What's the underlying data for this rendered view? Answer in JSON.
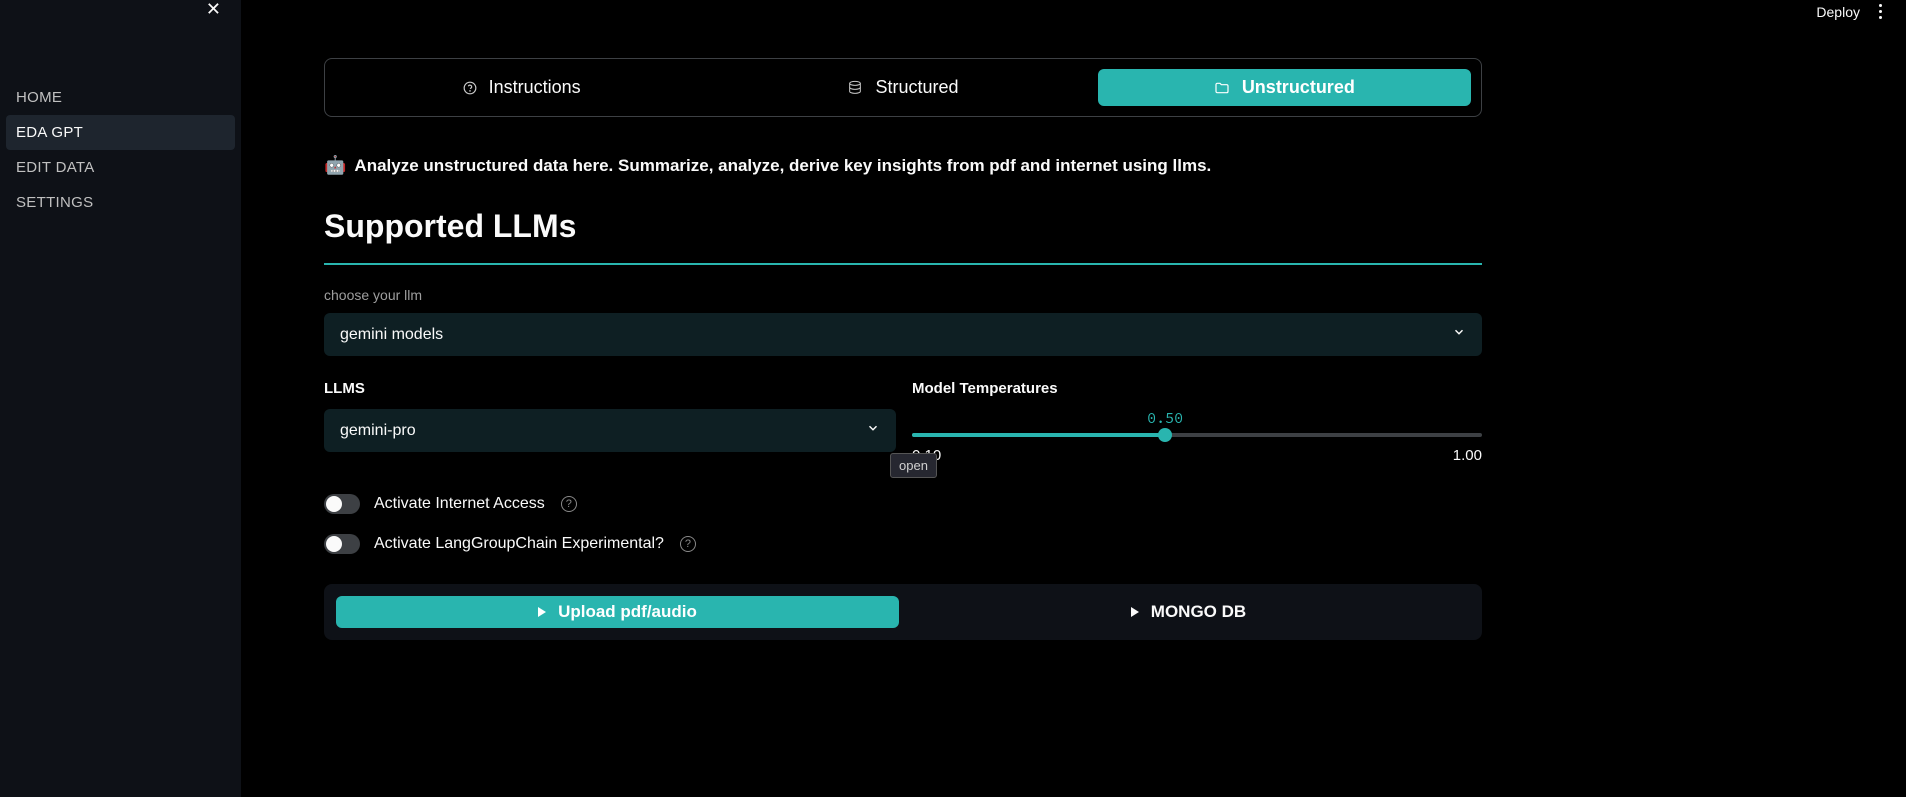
{
  "header": {
    "deploy_label": "Deploy"
  },
  "sidebar": {
    "items": [
      {
        "label": "HOME"
      },
      {
        "label": "EDA GPT"
      },
      {
        "label": "EDIT DATA"
      },
      {
        "label": "SETTINGS"
      }
    ],
    "active_index": 1
  },
  "tabs": {
    "items": [
      {
        "label": "Instructions"
      },
      {
        "label": "Structured"
      },
      {
        "label": "Unstructured"
      }
    ],
    "active_index": 2
  },
  "description": "Analyze unstructured data here. Summarize, analyze, derive key insights from pdf and internet using llms.",
  "section_heading": "Supported LLMs",
  "llm_category": {
    "label": "choose your llm",
    "value": "gemini models"
  },
  "llm_select": {
    "label": "LLMS",
    "value": "gemini-pro",
    "tooltip": "open"
  },
  "temperature": {
    "label": "Model Temperatures",
    "value": "0.50",
    "min": "0.10",
    "max": "1.00"
  },
  "toggles": {
    "internet": {
      "label": "Activate Internet Access",
      "on": false
    },
    "langgroup": {
      "label": "Activate LangGroupChain Experimental?",
      "on": false
    }
  },
  "expanders": {
    "upload": {
      "label": "Upload pdf/audio"
    },
    "mongo": {
      "label": "MONGO DB"
    }
  }
}
